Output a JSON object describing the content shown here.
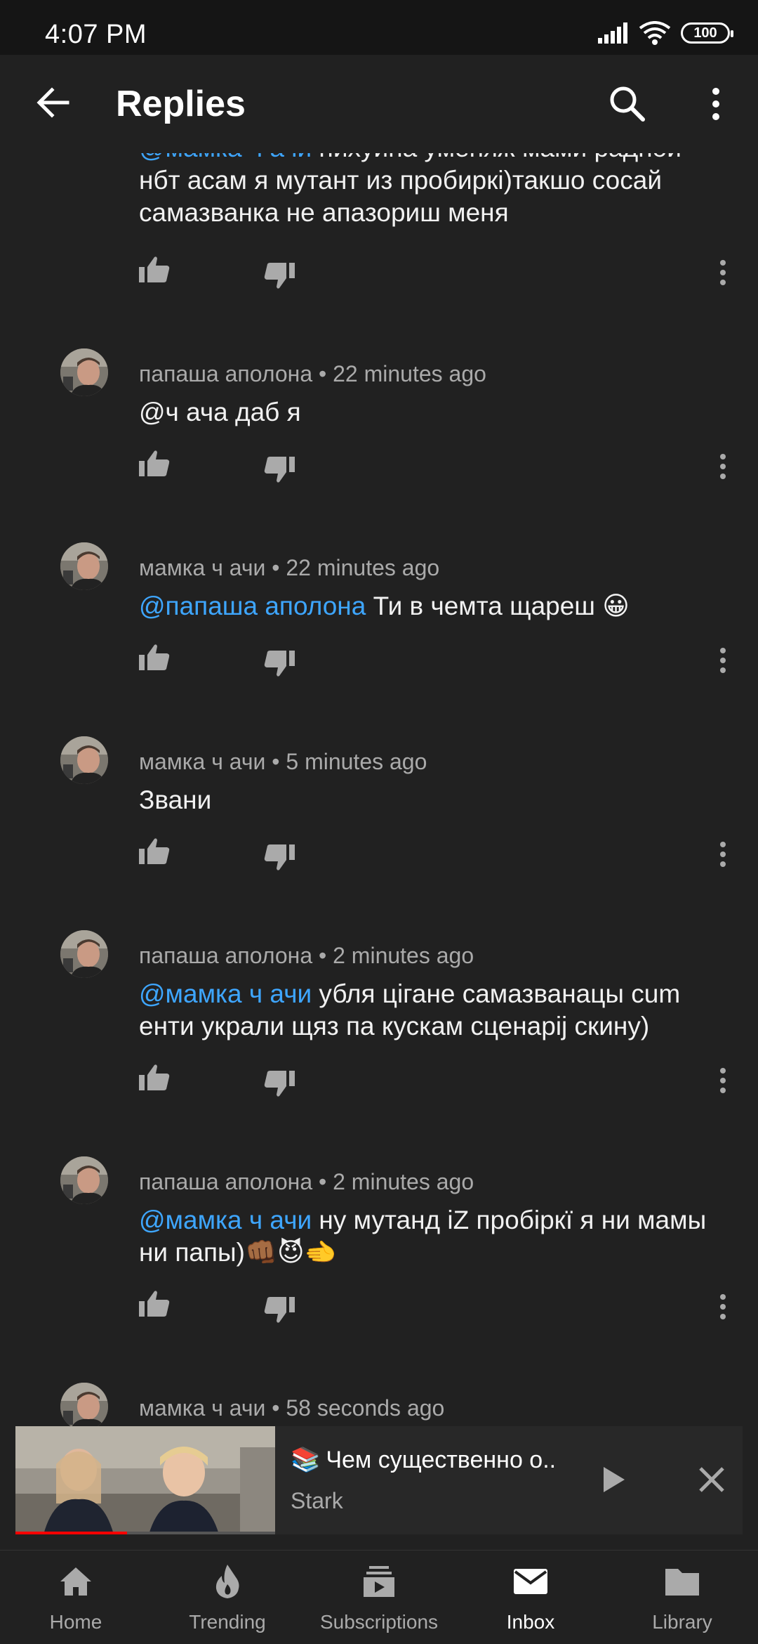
{
  "status_bar": {
    "time": "4:07 PM",
    "battery": "100"
  },
  "app_bar": {
    "title": "Replies"
  },
  "comments": [
    {
      "author": "",
      "age": "",
      "mention": "@мамка ч ачи",
      "text_line1": " нихуина уменяж мами радной",
      "text_rest": "нбт асам я мутант из пробиркі)такшо сосай самазванка не апазориш меня"
    },
    {
      "author": "папаша аполона",
      "age": "22 minutes ago",
      "mention": "",
      "text": "@ч ача даб я"
    },
    {
      "author": "мамка ч ачи",
      "age": "22 minutes ago",
      "mention": "@папаша аполона",
      "text": " Ти в чемта щареш 😀"
    },
    {
      "author": "мамка ч ачи",
      "age": "5 minutes ago",
      "mention": "",
      "text": "Звани"
    },
    {
      "author": "папаша аполона",
      "age": "2 minutes ago",
      "mention": "@мамка ч ачи",
      "text": " убля цігане самазванацы cum енти украли щяз па кускам сценарij скину)"
    },
    {
      "author": "папаша аполона",
      "age": "2 minutes ago",
      "mention": "@мамка ч ачи",
      "text": " ну мутанд iZ пробіркї я ни мамы ни папы)👊🏾😈🫲"
    },
    {
      "author": "мамка ч ачи",
      "age": "58 seconds ago",
      "mention": "",
      "text": ""
    }
  ],
  "separator": " • ",
  "mini_player": {
    "title": "Чем существенно о..",
    "title_emoji": "📚",
    "channel": "Stark",
    "progress": 0.43
  },
  "bottom_nav": [
    {
      "label": "Home",
      "icon": "home-icon",
      "active": false
    },
    {
      "label": "Trending",
      "icon": "trending-flame-icon",
      "active": false
    },
    {
      "label": "Subscriptions",
      "icon": "subscriptions-icon",
      "active": false
    },
    {
      "label": "Inbox",
      "icon": "inbox-mail-icon",
      "active": true
    },
    {
      "label": "Library",
      "icon": "library-folder-icon",
      "active": false
    }
  ],
  "colors": {
    "background": "#212121",
    "mention": "#3ea6ff",
    "muted": "#aaaaaa",
    "accent_red": "#ff0000"
  }
}
